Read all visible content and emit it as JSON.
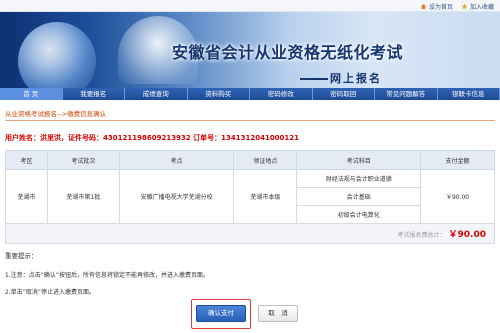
{
  "top_links": {
    "home": "设为首页",
    "favorite": "加入收藏"
  },
  "banner": {
    "title": "安徽省会计从业资格无纸化考试",
    "subtitle": "网上报名"
  },
  "nav": [
    "首 页",
    "我要报名",
    "成绩查询",
    "资料购买",
    "密码修改",
    "密码取回",
    "常见问题解答",
    "银联卡信息"
  ],
  "breadcrumb": "从业资格考试报名-->缴费信息确认",
  "user": {
    "name_label": "用户姓名：",
    "name": "洪里洪",
    "id_label": "，证件号码：",
    "id_number": "430121198609213932",
    "ticket_label": "订单号：",
    "ticket": "1341312041000121"
  },
  "table": {
    "headers": [
      "考区",
      "考试批次",
      "考点",
      "领证地点",
      "考试科目",
      "支付金额"
    ],
    "row": {
      "region": "芜湖市",
      "batch": "芜湖市第1批",
      "site": "安徽广播电视大学芜湖分校",
      "pickup": "芜湖市本级",
      "subjects": [
        "财经法规与会计职业道德",
        "会计基础",
        "初级会计电算化"
      ],
      "amount": "￥90.00"
    },
    "total_label": "考试报名费总计：",
    "total_value": "￥90.00"
  },
  "tips": {
    "title": "重要提示：",
    "line1": "1.注意：点击“确认”按钮后，所有信息将锁定不能再修改，并进入缴费页面。",
    "line2": "2.单击“取消”停止进入缴费页面。"
  },
  "buttons": {
    "confirm": "确认支付",
    "cancel": "取　消"
  },
  "colors": {
    "nav": "#1e4b95",
    "accent_red": "#d50000",
    "crumb": "#d24600"
  }
}
